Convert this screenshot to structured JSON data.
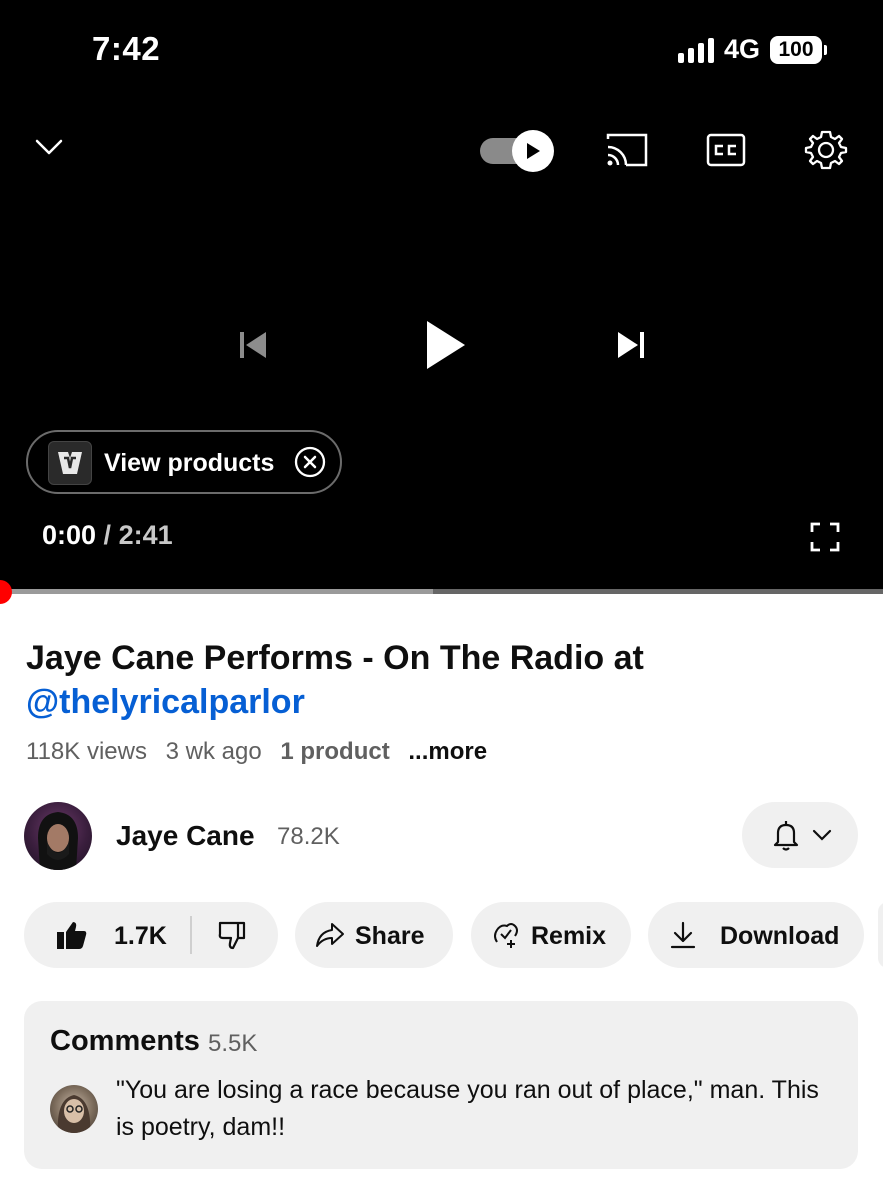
{
  "status_bar": {
    "time": "7:42",
    "network": "4G",
    "battery": "100"
  },
  "player": {
    "icons": {
      "collapse": "chevron-down-icon",
      "autoplay": "autoplay-toggle-icon",
      "cast": "cast-icon",
      "captions": "closed-captions-icon",
      "settings": "gear-icon",
      "previous": "skip-previous-icon",
      "play": "play-icon",
      "next": "skip-next-icon",
      "fullscreen": "fullscreen-icon"
    },
    "products_chip": {
      "label": "View products",
      "close_icon": "close-circle-icon"
    },
    "current_time": "0:00",
    "separator": " / ",
    "duration": "2:41",
    "progress_fraction": 0.0,
    "buffered_fraction": 0.49,
    "accent_color": "#ff0000"
  },
  "video": {
    "title": "Jaye Cane Performs - On The Radio at",
    "title_handle": "@thelyricalparlor",
    "views": "118K views",
    "age": "3 wk ago",
    "products": "1 product",
    "more": "...more"
  },
  "channel": {
    "name": "Jaye Cane",
    "subscribers": "78.2K"
  },
  "actions": {
    "likes": "1.7K",
    "share": "Share",
    "remix": "Remix",
    "download": "Download"
  },
  "comments": {
    "title": "Comments",
    "count": "5.5K",
    "top_comment": "\"You are losing a race because you ran out of place,\" man. This is poetry, dam!!"
  },
  "colors": {
    "link": "#065fd4",
    "pill_bg": "#f0f0f0",
    "progress": "#ff0000"
  }
}
